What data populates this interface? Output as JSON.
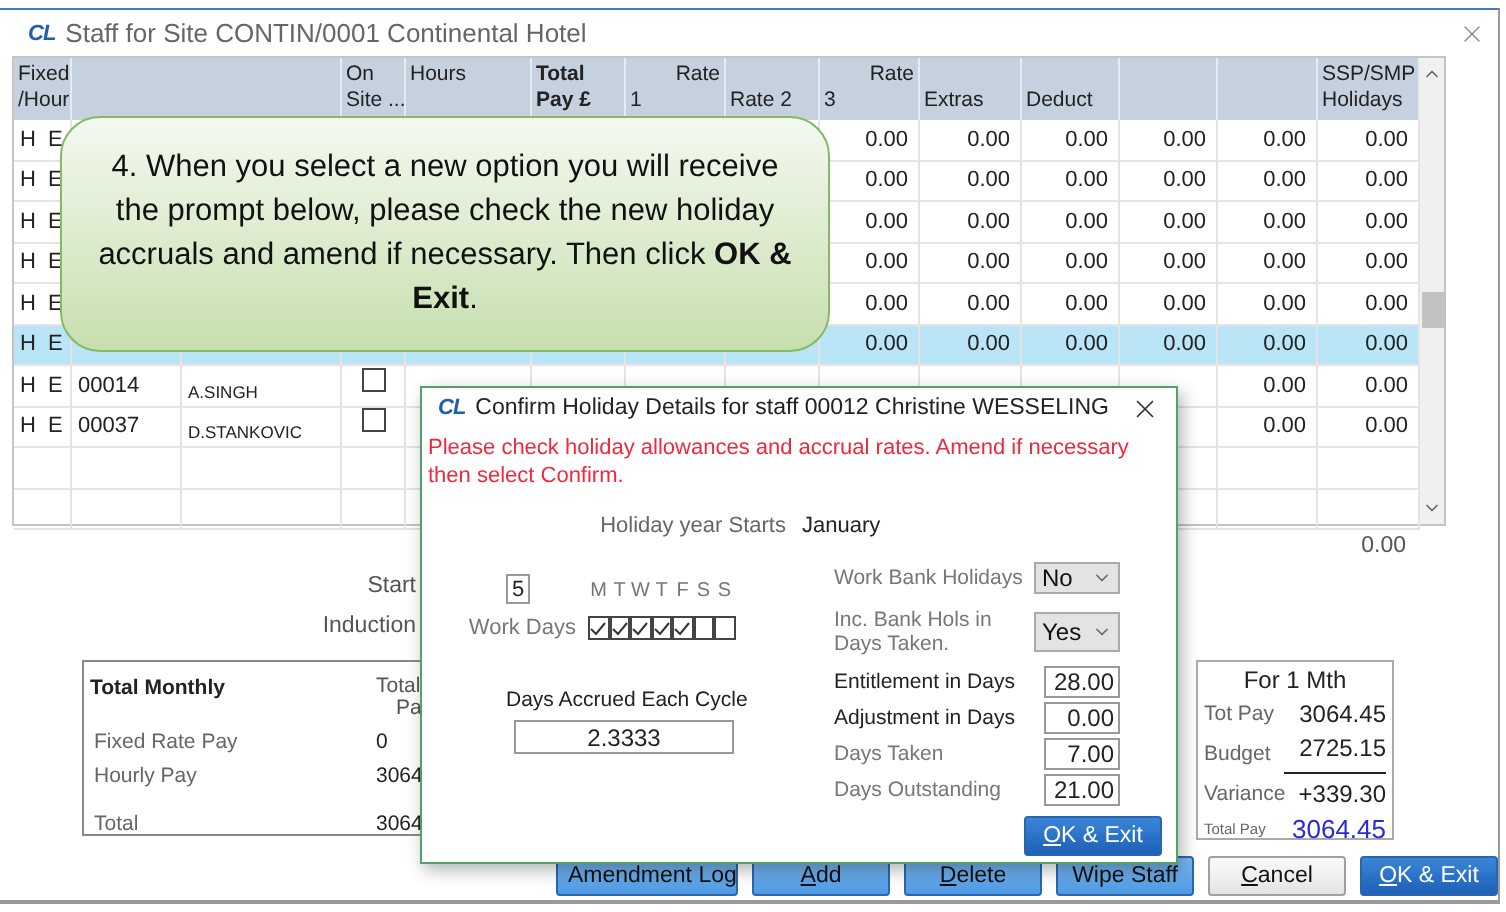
{
  "window": {
    "logo": "CL",
    "title": "Staff for Site CONTIN/0001 Continental Hotel"
  },
  "grid": {
    "columns": [
      {
        "kind": "stack",
        "lines": [
          "Fixed",
          "/Hour"
        ]
      },
      {
        "kind": "wide"
      },
      {
        "kind": "stack",
        "lines": [
          "On",
          "Site ..."
        ]
      },
      {
        "kind": "stack",
        "lines": [
          "Hours"
        ]
      },
      {
        "kind": "bold",
        "lines": [
          "Total",
          "Pay £"
        ]
      },
      {
        "kind": "split",
        "lines": [
          "Rate",
          "1"
        ]
      },
      {
        "kind": "low",
        "lines": [
          "Rate 2"
        ]
      },
      {
        "kind": "split",
        "lines": [
          "Rate",
          "3"
        ]
      },
      {
        "kind": "low",
        "lines": [
          "Extras"
        ]
      },
      {
        "kind": "low",
        "lines": [
          "Deduct"
        ]
      },
      {
        "kind": "blank"
      },
      {
        "kind": "blank"
      },
      {
        "kind": "stack",
        "lines": [
          "SSP/SMP",
          "Holidays"
        ]
      }
    ],
    "rows": [
      {
        "fixed": "H",
        "hour": "E",
        "selected": false,
        "values": [
          "0.00",
          "0.00",
          "0.00",
          "0.00",
          "0.00",
          "0.00"
        ]
      },
      {
        "fixed": "H",
        "hour": "E",
        "selected": false,
        "values": [
          "0.00",
          "0.00",
          "0.00",
          "0.00",
          "0.00",
          "0.00"
        ]
      },
      {
        "fixed": "H",
        "hour": "E",
        "selected": false,
        "values": [
          "0.00",
          "0.00",
          "0.00",
          "0.00",
          "0.00",
          "0.00"
        ]
      },
      {
        "fixed": "H",
        "hour": "E",
        "selected": false,
        "values": [
          "0.00",
          "0.00",
          "0.00",
          "0.00",
          "0.00",
          "0.00"
        ]
      },
      {
        "fixed": "H",
        "hour": "E",
        "selected": false,
        "values": [
          "0.00",
          "0.00",
          "0.00",
          "0.00",
          "0.00",
          "0.00"
        ]
      },
      {
        "fixed": "H",
        "hour": "E",
        "selected": true,
        "values": [
          "0.00",
          "0.00",
          "0.00",
          "0.00",
          "0.00",
          "0.00"
        ]
      },
      {
        "fixed": "H",
        "hour": "E",
        "id": "00014",
        "name": "A.SINGH",
        "on_site": false,
        "selected": false,
        "values": [
          "0.00",
          "0.00"
        ]
      },
      {
        "fixed": "H",
        "hour": "E",
        "id": "00037",
        "name": "D.STANKOVIC",
        "on_site": false,
        "selected": false,
        "values": [
          "0.00",
          "0.00"
        ]
      }
    ]
  },
  "total_below_grid": "0.00",
  "side_labels": [
    "Start",
    "Induction"
  ],
  "monthly": {
    "title": "Total Monthly",
    "column_heading": [
      "Total",
      "Pa"
    ],
    "rows": [
      {
        "label": "Fixed Rate Pay",
        "value": "0"
      },
      {
        "label": "Hourly Pay",
        "value": "3064"
      },
      {
        "label": "Total",
        "value": "3064"
      }
    ]
  },
  "period": {
    "title": "For  1 Mth",
    "tot_pay_label": "Tot Pay",
    "tot_pay": "3064.45",
    "budget_label": "Budget",
    "budget": "2725.15",
    "variance_label": "Variance",
    "variance": "+339.30",
    "total_pay_label": "Total Pay",
    "total_pay": "3064.45"
  },
  "buttons": [
    {
      "label": "Amendment Log",
      "kind": "light",
      "underline_first": false
    },
    {
      "label": "Add",
      "kind": "light",
      "underline_first": true
    },
    {
      "label": "Delete",
      "kind": "light",
      "underline_first": true
    },
    {
      "label": "Wipe Staff",
      "kind": "light",
      "underline_first": false
    },
    {
      "label": "Cancel",
      "kind": "plain",
      "underline_first": true
    },
    {
      "label": "OK & Exit",
      "kind": "primary",
      "underline_first": true
    }
  ],
  "callout": {
    "text": "4. When you select a new option you will receive the prompt below, please check the new holiday accruals and amend if necessary. Then click **OK & Exit**."
  },
  "dialog": {
    "logo": "CL",
    "title": "Confirm Holiday Details for staff 00012 Christine WESSELING",
    "message": "Please check holiday allowances and accrual rates. Amend if necessary then select Confirm.",
    "year_label": "Holiday year Starts",
    "year_value": "January",
    "days_count": "5",
    "work_days_label": "Work Days",
    "days": [
      {
        "letter": "M",
        "checked": true
      },
      {
        "letter": "T",
        "checked": true
      },
      {
        "letter": "W",
        "checked": true
      },
      {
        "letter": "T",
        "checked": true
      },
      {
        "letter": "F",
        "checked": true
      },
      {
        "letter": "S",
        "checked": false
      },
      {
        "letter": "S",
        "checked": false
      }
    ],
    "accrued_label": "Days Accrued Each Cycle",
    "accrued_value": "2.3333",
    "selects": [
      {
        "label": "Work Bank Holidays",
        "value": "No"
      },
      {
        "label": "Inc. Bank Hols in Days Taken.",
        "value": "Yes"
      }
    ],
    "fields": [
      {
        "label": "Entitlement in Days",
        "value": "28.00",
        "strong": true
      },
      {
        "label": "Adjustment in Days",
        "value": "0.00",
        "strong": true
      },
      {
        "label": "Days Taken",
        "value": "7.00",
        "strong": false
      },
      {
        "label": "Days Outstanding",
        "value": "21.00",
        "strong": false
      }
    ],
    "ok_button": {
      "label": "OK & Exit",
      "underline_first": true
    }
  }
}
